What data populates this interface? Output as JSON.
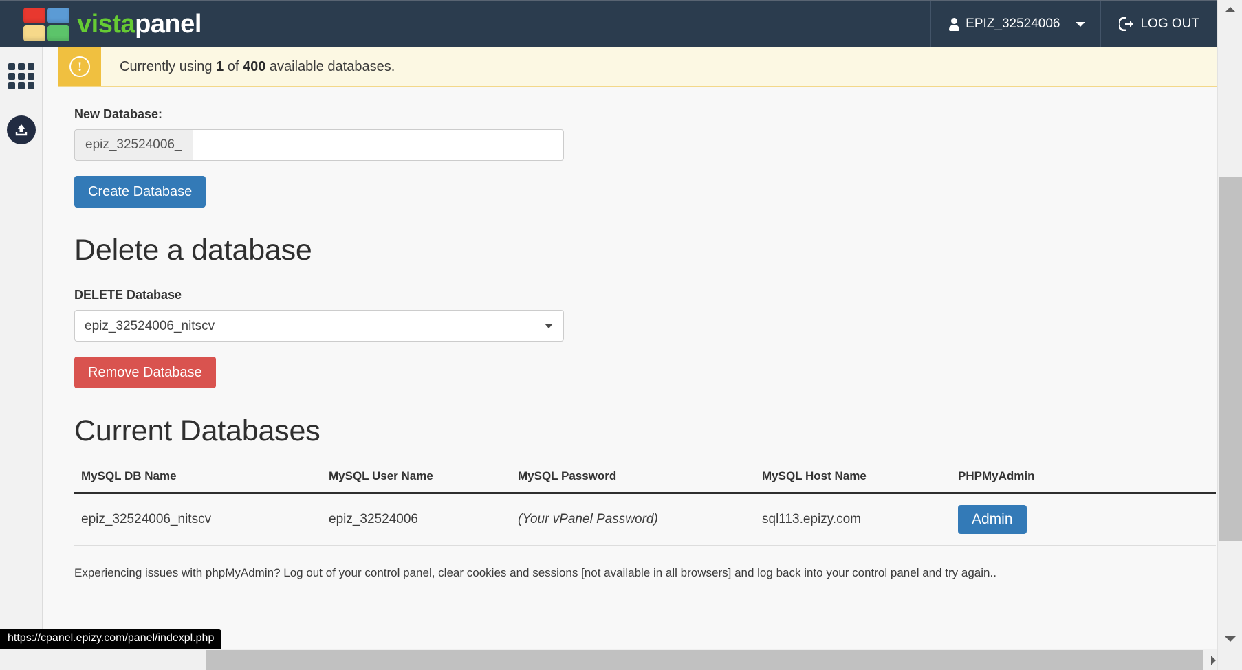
{
  "navbar": {
    "brand_first": "vista",
    "brand_second": "panel",
    "logo_icon": "vistapanel-logo-icon",
    "user_label": "EPIZ_32524006",
    "user_icon": "person-icon",
    "caret_icon": "chevron-down-icon",
    "logout_label": "LOG OUT",
    "logout_icon": "logout-icon"
  },
  "sidebar": {
    "items": [
      {
        "name": "apps-grid-icon",
        "label": ""
      },
      {
        "name": "upload-icon",
        "label": ""
      }
    ]
  },
  "alert": {
    "icon": "exclamation-circle-icon",
    "icon_glyph": "!",
    "prefix": "Currently using ",
    "used": "1",
    "middle": " of ",
    "total": "400",
    "suffix": " available databases."
  },
  "new_database": {
    "label": "New Database:",
    "prefix": "epiz_32524006_",
    "value": "",
    "placeholder": "",
    "create_button": "Create Database"
  },
  "delete_database": {
    "heading": "Delete a database",
    "label": "DELETE Database",
    "selected": "epiz_32524006_nitscv",
    "options": [
      "epiz_32524006_nitscv"
    ],
    "remove_button": "Remove Database"
  },
  "current_databases": {
    "heading": "Current Databases",
    "columns": [
      "MySQL DB Name",
      "MySQL User Name",
      "MySQL Password",
      "MySQL Host Name",
      "PHPMyAdmin"
    ],
    "rows": [
      {
        "db_name": "epiz_32524006_nitscv",
        "user_name": "epiz_32524006",
        "password": "(Your vPanel Password)",
        "host_name": "sql113.epizy.com",
        "admin_button": "Admin"
      }
    ]
  },
  "help_note": "Experiencing issues with phpMyAdmin? Log out of your control panel, clear cookies and sessions [not available in all browsers] and log back into your control panel and try again..",
  "status_bar": {
    "url": "https://cpanel.epizy.com/panel/indexpl.php"
  },
  "colors": {
    "navbar_bg": "#2b3c4e",
    "brand_green": "#66cc33",
    "primary_blue": "#337ab7",
    "danger_red": "#d9534f",
    "alert_bg": "#fcf8e3",
    "alert_icon_bg": "#f0c040"
  }
}
